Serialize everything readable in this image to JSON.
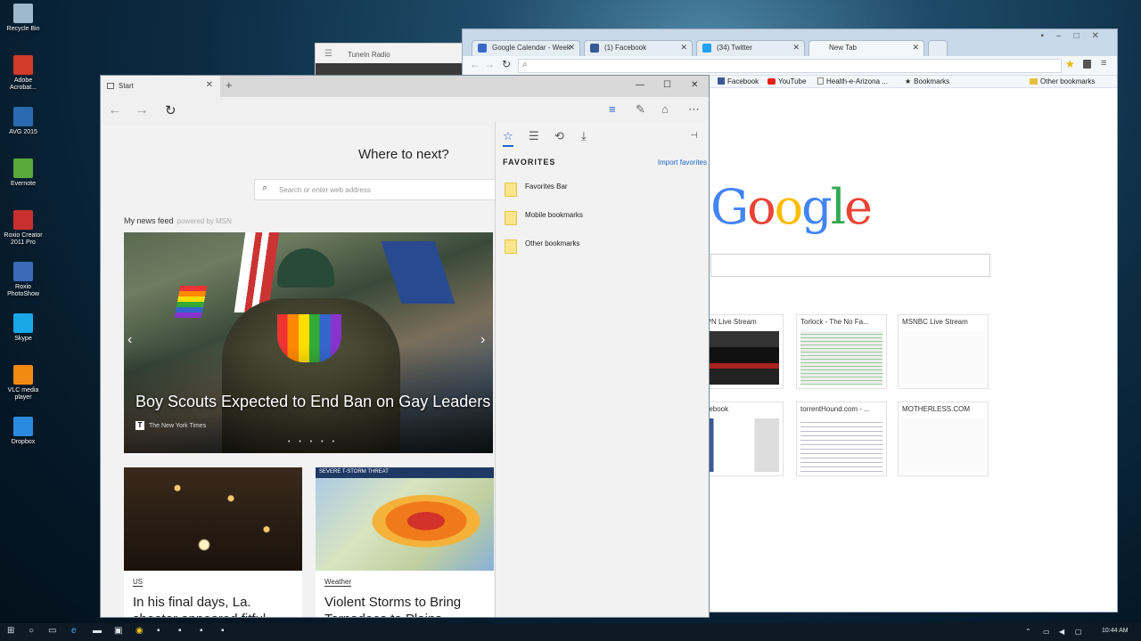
{
  "desktop": {
    "icons": [
      {
        "label": "Recycle Bin",
        "icon": "recycle-bin-icon",
        "color": "#9fb8cc"
      },
      {
        "label": "Adobe Acrobat...",
        "icon": "adobe-acrobat-icon",
        "color": "#d23a2a"
      },
      {
        "label": "AVG 2015",
        "icon": "avg-icon",
        "color": "#2a6ab0"
      },
      {
        "label": "Evernote",
        "icon": "evernote-icon",
        "color": "#58a83a"
      },
      {
        "label": "Roxio Creator 2011 Pro",
        "icon": "roxio-creator-icon",
        "color": "#c83030"
      },
      {
        "label": "Roxio PhotoShow",
        "icon": "roxio-photoshow-icon",
        "color": "#3a6ab8"
      },
      {
        "label": "Skype",
        "icon": "skype-icon",
        "color": "#18a8e8"
      },
      {
        "label": "VLC media player",
        "icon": "vlc-icon",
        "color": "#f08a10"
      },
      {
        "label": "Dropbox",
        "icon": "dropbox-icon",
        "color": "#2a8ae0"
      }
    ]
  },
  "chrome": {
    "tabs": [
      {
        "label": "Google Calendar - Week",
        "favicon_color": "#3a6ac8"
      },
      {
        "label": "(1) Facebook",
        "favicon_color": "#3b5998"
      },
      {
        "label": "(34) Twitter",
        "favicon_color": "#1da1f2"
      },
      {
        "label": "New Tab",
        "favicon_color": "#ffffff"
      }
    ],
    "bookmarks": [
      "Facebook",
      "YouTube",
      "Health-e-Arizona ...",
      "Bookmarks",
      "Other bookmarks"
    ],
    "google_logo": [
      "G",
      "o",
      "o",
      "g",
      "l",
      "e"
    ],
    "google_colors": [
      "#4285f4",
      "#ea4335",
      "#fbbc05",
      "#4285f4",
      "#34a853",
      "#ea4335"
    ],
    "tiles": [
      "ESPN Live Stream",
      "Torlock - The No Fa...",
      "MSNBC Live Stream",
      "Facebook",
      "torrentHound.com - ...",
      "MOTHERLESS.COM"
    ]
  },
  "tunein": {
    "title": "TuneIn Radio"
  },
  "edge": {
    "tab_label": "Start",
    "heading": "Where to next?",
    "search_placeholder": "Search or enter web address",
    "news_feed_label": "My news feed",
    "news_feed_powered": "powered by MSN",
    "hero": {
      "headline": "Boy Scouts Expected to End Ban on Gay Leaders",
      "source": "The New York Times"
    },
    "cards": [
      {
        "category": "US",
        "title": "In his final days, La. shooter appeared fitful"
      },
      {
        "category": "Weather",
        "title": "Violent Storms to Bring Tornadoes to Plains"
      }
    ],
    "weather_header": "SEVERE T-STORM THREAT",
    "hub": {
      "title": "FAVORITES",
      "import_label": "Import favorites",
      "items": [
        "Favorites Bar",
        "Mobile bookmarks",
        "Other bookmarks"
      ]
    }
  },
  "taskbar": {
    "time": "10:44 AM"
  }
}
